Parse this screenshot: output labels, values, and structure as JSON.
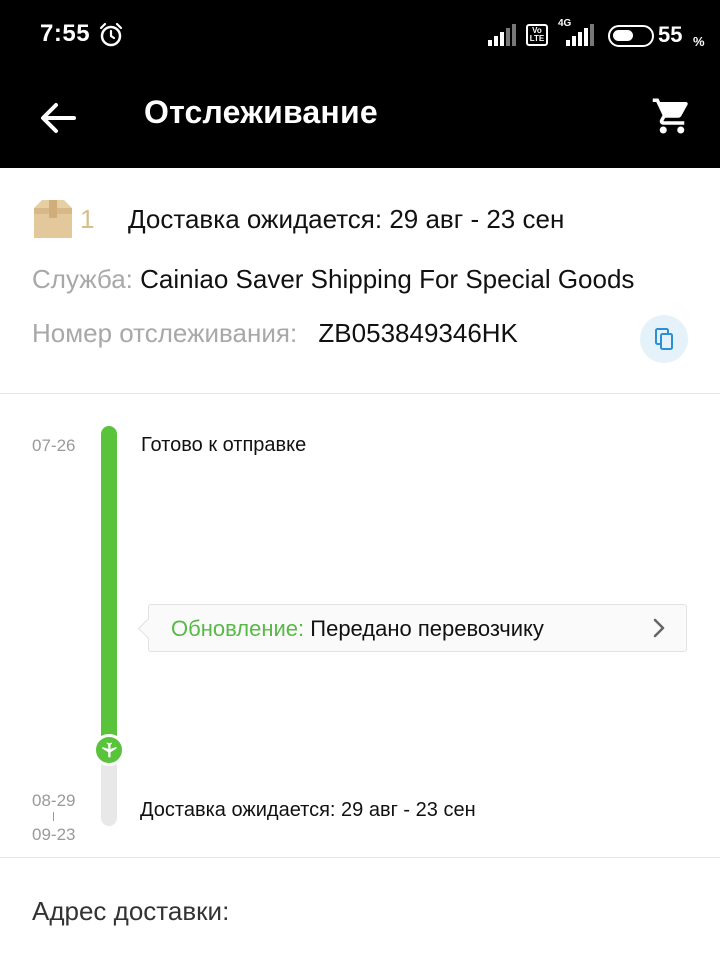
{
  "status_bar": {
    "time": "7:55",
    "volte_label": "Vo LTE",
    "network_label": "4G",
    "battery_percent": "55",
    "battery_sign": "%"
  },
  "app_bar": {
    "title": "Отслеживание"
  },
  "shipment": {
    "package_count": "1",
    "delivery_estimate": "Доставка ожидается: 29 авг - 23 сен",
    "service_label": "Служба:",
    "service_value": "Cainiao Saver Shipping For Special Goods",
    "tracking_label": "Номер отслеживания:",
    "tracking_number": "ZB053849346HK"
  },
  "timeline": {
    "events": [
      {
        "date": "07-26",
        "text": "Готово к отправке"
      }
    ],
    "update": {
      "label": "Обновление:",
      "value": "Передано перевозчику"
    },
    "estimate": {
      "date_from": "08-29",
      "date_to": "09-23",
      "text": "Доставка ожидается: 29 авг - 23 сен"
    },
    "progress_color": "#58c33b"
  },
  "address": {
    "title": "Адрес доставки:"
  },
  "icons": {
    "back": "arrow-left-icon",
    "cart": "shopping-cart-icon",
    "copy": "copy-icon",
    "package": "package-box-icon",
    "plane": "airplane-icon",
    "chevron": "chevron-right-icon"
  }
}
